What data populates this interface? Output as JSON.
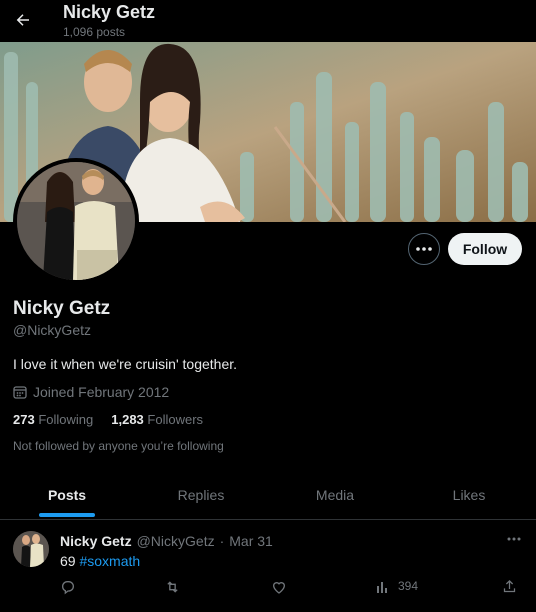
{
  "header": {
    "name": "Nicky Getz",
    "posts_count": "1,096 posts"
  },
  "profile": {
    "display_name": "Nicky Getz",
    "handle": "@NickyGetz",
    "bio": "I love it when we're cruisin' together.",
    "joined": "Joined February 2012",
    "following_count": "273",
    "following_label": "Following",
    "followers_count": "1,283",
    "followers_label": "Followers",
    "not_followed": "Not followed by anyone you’re following"
  },
  "actions": {
    "more_icon": "more-dots-icon",
    "follow_label": "Follow"
  },
  "tabs": [
    {
      "label": "Posts",
      "active": true
    },
    {
      "label": "Replies",
      "active": false
    },
    {
      "label": "Media",
      "active": false
    },
    {
      "label": "Likes",
      "active": false
    }
  ],
  "tweet": {
    "name": "Nicky Getz",
    "handle": "@NickyGetz",
    "separator": "·",
    "date": "Mar 31",
    "text_prefix": "69",
    "hashtag": "#soxmath",
    "views": "394"
  },
  "colors": {
    "background": "#000000",
    "accent": "#1d9bf0",
    "muted": "#71767b",
    "text": "#e7e9ea",
    "follow_button": "#eff3f4"
  }
}
